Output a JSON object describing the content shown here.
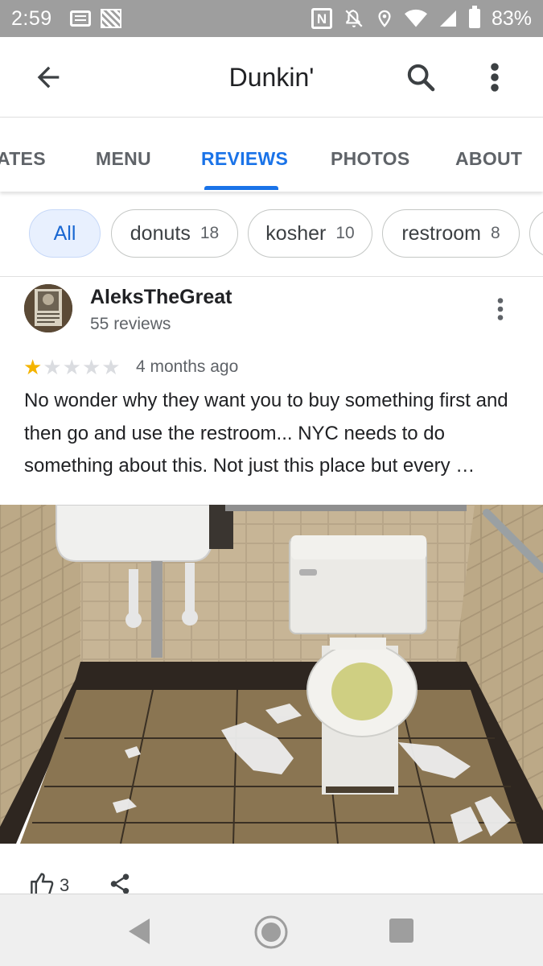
{
  "status_bar": {
    "time": "2:59",
    "battery": "83%",
    "icons": [
      "notification-box-icon",
      "picture-icon",
      "nfc-icon",
      "mute-icon",
      "location-icon",
      "wifi-icon",
      "signal-icon",
      "battery-icon"
    ]
  },
  "app_bar": {
    "title": "Dunkin'",
    "icons": [
      "back-arrow-icon",
      "search-icon",
      "more-vert-icon"
    ]
  },
  "tabs": [
    {
      "label": "ATES"
    },
    {
      "label": "MENU"
    },
    {
      "label": "REVIEWS",
      "active": true
    },
    {
      "label": "PHOTOS"
    },
    {
      "label": "ABOUT"
    }
  ],
  "chips": [
    {
      "label": "All",
      "selected": true
    },
    {
      "label": "donuts",
      "count": "18"
    },
    {
      "label": "kosher",
      "count": "10"
    },
    {
      "label": "restroom",
      "count": "8"
    }
  ],
  "review": {
    "author": "AleksTheGreat",
    "author_reviews": "55 reviews",
    "rating": 1,
    "rating_max": 5,
    "date": "4 months ago",
    "text": "No wonder why they want you to buy something first and then go and use the restroom... NYC needs to do something about this. Not just this place but every …",
    "likes": "3"
  },
  "colors": {
    "accent": "#1a73e8",
    "star": "#f4b400",
    "status_bar": "#9e9e9e"
  }
}
